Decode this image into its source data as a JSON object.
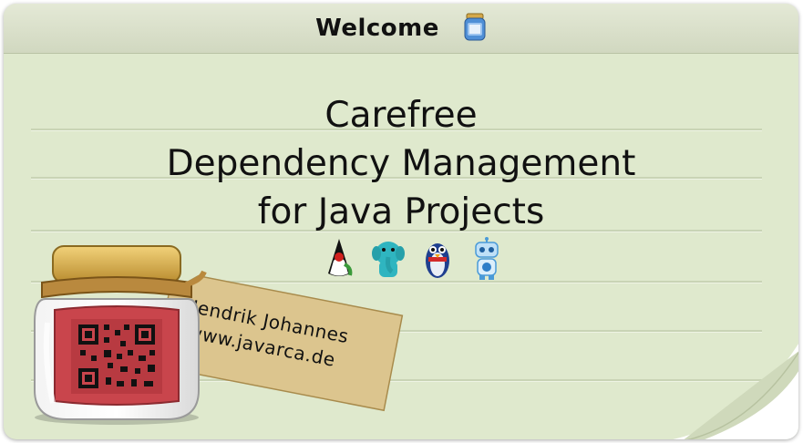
{
  "window": {
    "title": "Welcome",
    "icon": "jar-icon"
  },
  "heading": {
    "line1": "Carefree",
    "line2": "Dependency Management",
    "line3": "for Java Projects"
  },
  "mascots": [
    "duke-icon",
    "elephant-icon",
    "penguin-icon",
    "robot-icon"
  ],
  "tag": {
    "name": "Jendrik Johannes",
    "url": "www.javarca.de"
  },
  "colors": {
    "paper": "#dfe9cd",
    "titlebar": "#d1d8c0",
    "jar_label": "#c9454c",
    "jar_lid": "#d6a93d",
    "tag": "#dcc58e"
  }
}
